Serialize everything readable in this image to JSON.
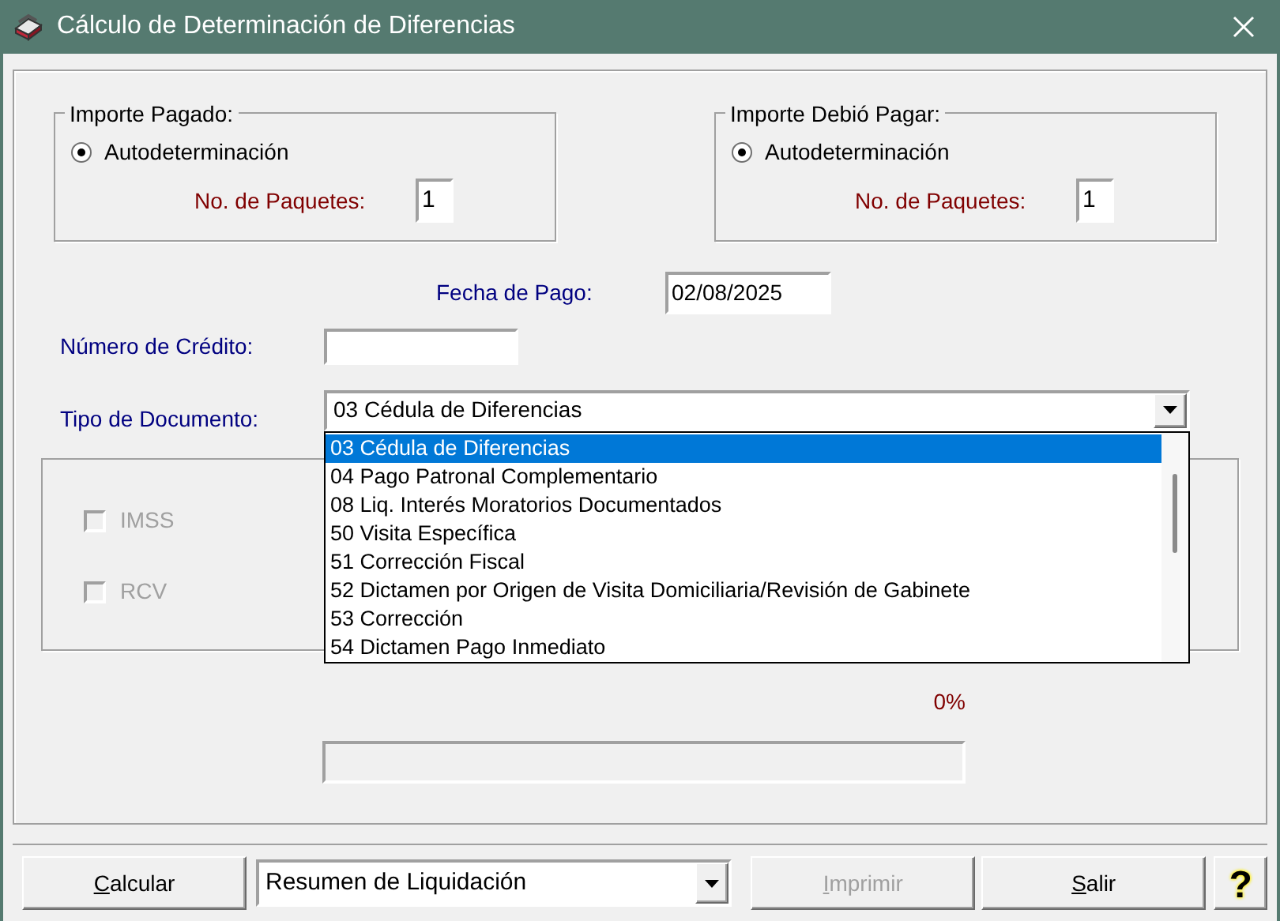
{
  "window": {
    "title": "Cálculo de Determinación de Diferencias"
  },
  "groups": [
    {
      "title": "Importe Pagado:",
      "option": {
        "label": "Autodeterminación",
        "selected": true
      },
      "packages_label": "No. de Paquetes:",
      "packages_value": "1"
    },
    {
      "title": "Importe Debió Pagar:",
      "option": {
        "label": "Autodeterminación",
        "selected": true
      },
      "packages_label": "No. de Paquetes:",
      "packages_value": "1"
    }
  ],
  "fecha_pago": {
    "label": "Fecha de Pago:",
    "value": "02/08/2025"
  },
  "numero_credito": {
    "label": "Número de Crédito:"
  },
  "tipo_documento": {
    "label": "Tipo de Documento:",
    "value": "03 Cédula de Diferencias",
    "expanded": true,
    "options": [
      {
        "label": "03 Cédula de Diferencias",
        "selected": true
      },
      {
        "label": "04 Pago Patronal Complementario",
        "selected": false
      },
      {
        "label": "08 Liq. Interés Moratorios Documentados",
        "selected": false
      },
      {
        "label": "50 Visita Específica",
        "selected": false
      },
      {
        "label": "51 Corrección Fiscal",
        "selected": false
      },
      {
        "label": "52 Dictamen por Origen de Visita Domiciliaria/Revisión de Gabinete",
        "selected": false
      },
      {
        "label": "53 Corrección",
        "selected": false
      },
      {
        "label": "54 Dictamen Pago Inmediato",
        "selected": false
      }
    ]
  },
  "checkboxes": [
    {
      "label": "IMSS",
      "checked": false,
      "disabled": true
    },
    {
      "label": "RCV",
      "checked": false,
      "disabled": true
    }
  ],
  "progress": {
    "reading": "0%",
    "level": 0
  },
  "footer": [
    {
      "kind": "button",
      "label": "Calcular",
      "disabled": false
    },
    {
      "kind": "select",
      "value": "Resumen de Liquidación"
    },
    {
      "kind": "button",
      "label": "Imprimir",
      "disabled": true
    },
    {
      "kind": "button",
      "label": "Salir",
      "disabled": false
    },
    {
      "kind": "help",
      "label": "?"
    }
  ]
}
